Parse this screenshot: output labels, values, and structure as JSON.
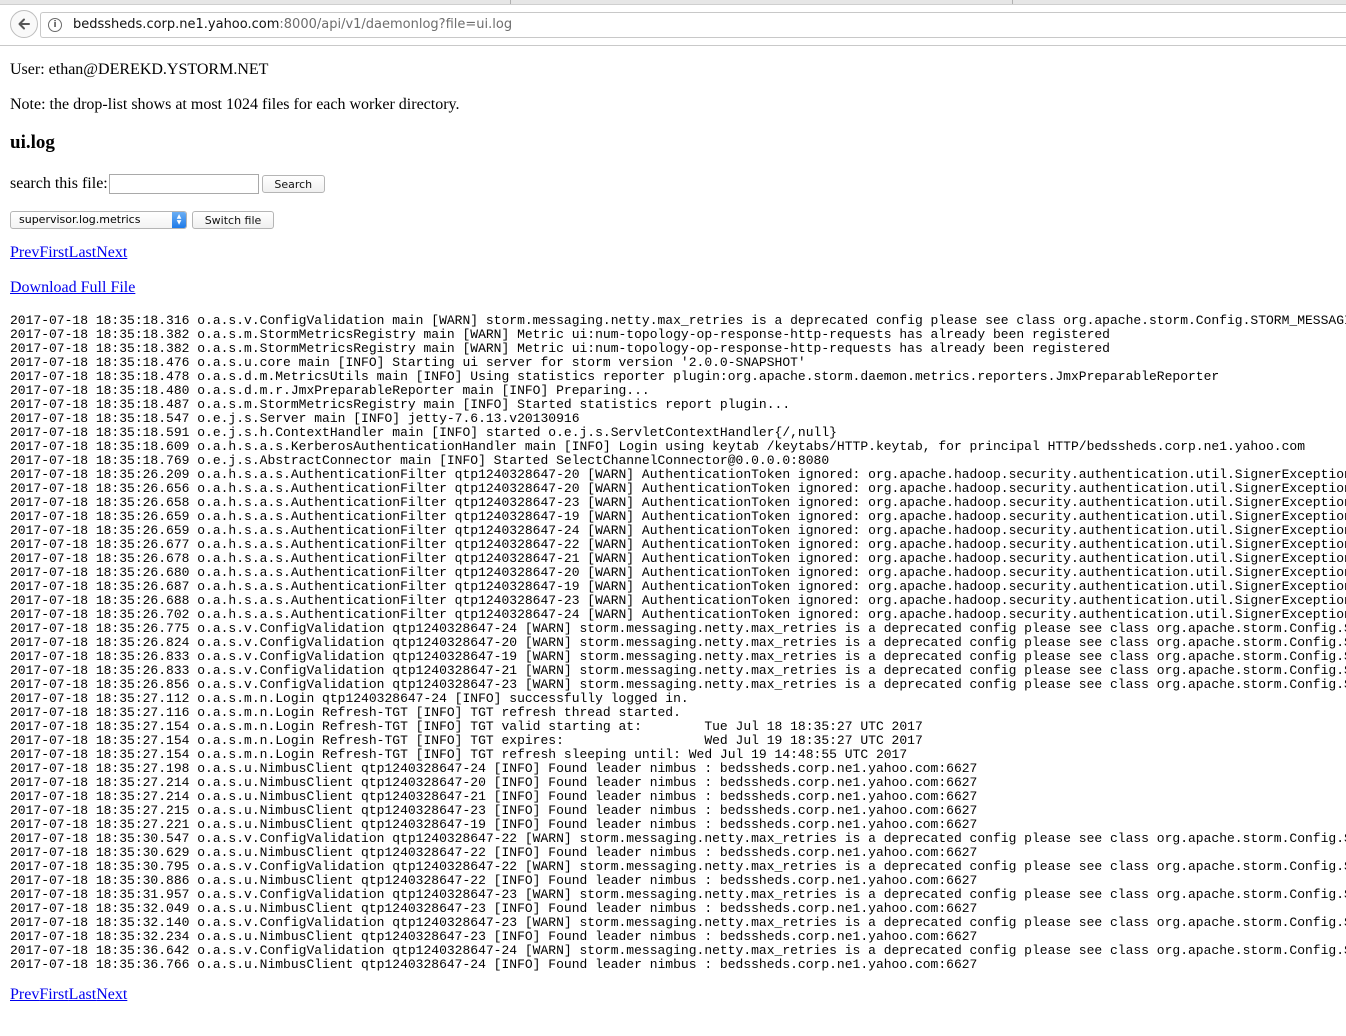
{
  "browser": {
    "url_host": "bedssheds.corp.ne1.yahoo.com",
    "url_rest": ":8000/api/v1/daemonlog?file=ui.log"
  },
  "page": {
    "user_line": "User: ethan@DEREKD.YSTORM.NET",
    "note": "Note: the drop-list shows at most 1024 files for each worker directory.",
    "filename": "ui.log",
    "search_label": "search this file:",
    "search_value": "",
    "search_button": "Search",
    "file_select_value": "supervisor.log.metrics",
    "switch_button": "Switch file",
    "nav": {
      "prev": "Prev",
      "first": "First",
      "last": "Last",
      "next": "Next"
    },
    "download_link": "Download Full File"
  },
  "log_lines": [
    "2017-07-18 18:35:18.316 o.a.s.v.ConfigValidation main [WARN] storm.messaging.netty.max_retries is a deprecated config please see class org.apache.storm.Config.STORM_MESSAGI",
    "2017-07-18 18:35:18.382 o.a.s.m.StormMetricsRegistry main [WARN] Metric ui:num-topology-op-response-http-requests has already been registered",
    "2017-07-18 18:35:18.382 o.a.s.m.StormMetricsRegistry main [WARN] Metric ui:num-topology-op-response-http-requests has already been registered",
    "2017-07-18 18:35:18.476 o.a.s.u.core main [INFO] Starting ui server for storm version '2.0.0-SNAPSHOT'",
    "2017-07-18 18:35:18.478 o.a.s.d.m.MetricsUtils main [INFO] Using statistics reporter plugin:org.apache.storm.daemon.metrics.reporters.JmxPreparableReporter",
    "2017-07-18 18:35:18.480 o.a.s.d.m.r.JmxPreparableReporter main [INFO] Preparing...",
    "2017-07-18 18:35:18.487 o.a.s.m.StormMetricsRegistry main [INFO] Started statistics report plugin...",
    "2017-07-18 18:35:18.547 o.e.j.s.Server main [INFO] jetty-7.6.13.v20130916",
    "2017-07-18 18:35:18.591 o.e.j.s.h.ContextHandler main [INFO] started o.e.j.s.ServletContextHandler{/,null}",
    "2017-07-18 18:35:18.609 o.a.h.s.a.s.KerberosAuthenticationHandler main [INFO] Login using keytab /keytabs/HTTP.keytab, for principal HTTP/bedssheds.corp.ne1.yahoo.com",
    "2017-07-18 18:35:18.769 o.e.j.s.AbstractConnector main [INFO] Started SelectChannelConnector@0.0.0.0:8080",
    "2017-07-18 18:35:26.209 o.a.h.s.a.s.AuthenticationFilter qtp1240328647-20 [WARN] AuthenticationToken ignored: org.apache.hadoop.security.authentication.util.SignerException",
    "2017-07-18 18:35:26.656 o.a.h.s.a.s.AuthenticationFilter qtp1240328647-20 [WARN] AuthenticationToken ignored: org.apache.hadoop.security.authentication.util.SignerException",
    "2017-07-18 18:35:26.658 o.a.h.s.a.s.AuthenticationFilter qtp1240328647-23 [WARN] AuthenticationToken ignored: org.apache.hadoop.security.authentication.util.SignerException",
    "2017-07-18 18:35:26.659 o.a.h.s.a.s.AuthenticationFilter qtp1240328647-19 [WARN] AuthenticationToken ignored: org.apache.hadoop.security.authentication.util.SignerException",
    "2017-07-18 18:35:26.659 o.a.h.s.a.s.AuthenticationFilter qtp1240328647-24 [WARN] AuthenticationToken ignored: org.apache.hadoop.security.authentication.util.SignerException",
    "2017-07-18 18:35:26.677 o.a.h.s.a.s.AuthenticationFilter qtp1240328647-22 [WARN] AuthenticationToken ignored: org.apache.hadoop.security.authentication.util.SignerException",
    "2017-07-18 18:35:26.678 o.a.h.s.a.s.AuthenticationFilter qtp1240328647-21 [WARN] AuthenticationToken ignored: org.apache.hadoop.security.authentication.util.SignerException",
    "2017-07-18 18:35:26.680 o.a.h.s.a.s.AuthenticationFilter qtp1240328647-20 [WARN] AuthenticationToken ignored: org.apache.hadoop.security.authentication.util.SignerException",
    "2017-07-18 18:35:26.687 o.a.h.s.a.s.AuthenticationFilter qtp1240328647-19 [WARN] AuthenticationToken ignored: org.apache.hadoop.security.authentication.util.SignerException",
    "2017-07-18 18:35:26.688 o.a.h.s.a.s.AuthenticationFilter qtp1240328647-23 [WARN] AuthenticationToken ignored: org.apache.hadoop.security.authentication.util.SignerException",
    "2017-07-18 18:35:26.702 o.a.h.s.a.s.AuthenticationFilter qtp1240328647-24 [WARN] AuthenticationToken ignored: org.apache.hadoop.security.authentication.util.SignerException",
    "2017-07-18 18:35:26.775 o.a.s.v.ConfigValidation qtp1240328647-24 [WARN] storm.messaging.netty.max_retries is a deprecated config please see class org.apache.storm.Config.S",
    "2017-07-18 18:35:26.824 o.a.s.v.ConfigValidation qtp1240328647-20 [WARN] storm.messaging.netty.max_retries is a deprecated config please see class org.apache.storm.Config.S",
    "2017-07-18 18:35:26.833 o.a.s.v.ConfigValidation qtp1240328647-19 [WARN] storm.messaging.netty.max_retries is a deprecated config please see class org.apache.storm.Config.S",
    "2017-07-18 18:35:26.833 o.a.s.v.ConfigValidation qtp1240328647-21 [WARN] storm.messaging.netty.max_retries is a deprecated config please see class org.apache.storm.Config.S",
    "2017-07-18 18:35:26.856 o.a.s.v.ConfigValidation qtp1240328647-23 [WARN] storm.messaging.netty.max_retries is a deprecated config please see class org.apache.storm.Config.S",
    "2017-07-18 18:35:27.112 o.a.s.m.n.Login qtp1240328647-24 [INFO] successfully logged in.",
    "2017-07-18 18:35:27.116 o.a.s.m.n.Login Refresh-TGT [INFO] TGT refresh thread started.",
    "2017-07-18 18:35:27.154 o.a.s.m.n.Login Refresh-TGT [INFO] TGT valid starting at:        Tue Jul 18 18:35:27 UTC 2017",
    "2017-07-18 18:35:27.154 o.a.s.m.n.Login Refresh-TGT [INFO] TGT expires:                  Wed Jul 19 18:35:27 UTC 2017",
    "2017-07-18 18:35:27.154 o.a.s.m.n.Login Refresh-TGT [INFO] TGT refresh sleeping until: Wed Jul 19 14:48:55 UTC 2017",
    "2017-07-18 18:35:27.198 o.a.s.u.NimbusClient qtp1240328647-24 [INFO] Found leader nimbus : bedssheds.corp.ne1.yahoo.com:6627",
    "2017-07-18 18:35:27.214 o.a.s.u.NimbusClient qtp1240328647-20 [INFO] Found leader nimbus : bedssheds.corp.ne1.yahoo.com:6627",
    "2017-07-18 18:35:27.214 o.a.s.u.NimbusClient qtp1240328647-21 [INFO] Found leader nimbus : bedssheds.corp.ne1.yahoo.com:6627",
    "2017-07-18 18:35:27.215 o.a.s.u.NimbusClient qtp1240328647-23 [INFO] Found leader nimbus : bedssheds.corp.ne1.yahoo.com:6627",
    "2017-07-18 18:35:27.221 o.a.s.u.NimbusClient qtp1240328647-19 [INFO] Found leader nimbus : bedssheds.corp.ne1.yahoo.com:6627",
    "2017-07-18 18:35:30.547 o.a.s.v.ConfigValidation qtp1240328647-22 [WARN] storm.messaging.netty.max_retries is a deprecated config please see class org.apache.storm.Config.S",
    "2017-07-18 18:35:30.629 o.a.s.u.NimbusClient qtp1240328647-22 [INFO] Found leader nimbus : bedssheds.corp.ne1.yahoo.com:6627",
    "2017-07-18 18:35:30.795 o.a.s.v.ConfigValidation qtp1240328647-22 [WARN] storm.messaging.netty.max_retries is a deprecated config please see class org.apache.storm.Config.S",
    "2017-07-18 18:35:30.886 o.a.s.u.NimbusClient qtp1240328647-22 [INFO] Found leader nimbus : bedssheds.corp.ne1.yahoo.com:6627",
    "2017-07-18 18:35:31.957 o.a.s.v.ConfigValidation qtp1240328647-23 [WARN] storm.messaging.netty.max_retries is a deprecated config please see class org.apache.storm.Config.S",
    "2017-07-18 18:35:32.049 o.a.s.u.NimbusClient qtp1240328647-23 [INFO] Found leader nimbus : bedssheds.corp.ne1.yahoo.com:6627",
    "2017-07-18 18:35:32.140 o.a.s.v.ConfigValidation qtp1240328647-23 [WARN] storm.messaging.netty.max_retries is a deprecated config please see class org.apache.storm.Config.S",
    "2017-07-18 18:35:32.234 o.a.s.u.NimbusClient qtp1240328647-23 [INFO] Found leader nimbus : bedssheds.corp.ne1.yahoo.com:6627",
    "2017-07-18 18:35:36.642 o.a.s.v.ConfigValidation qtp1240328647-24 [WARN] storm.messaging.netty.max_retries is a deprecated config please see class org.apache.storm.Config.S",
    "2017-07-18 18:35:36.766 o.a.s.u.NimbusClient qtp1240328647-24 [INFO] Found leader nimbus : bedssheds.corp.ne1.yahoo.com:6627"
  ]
}
